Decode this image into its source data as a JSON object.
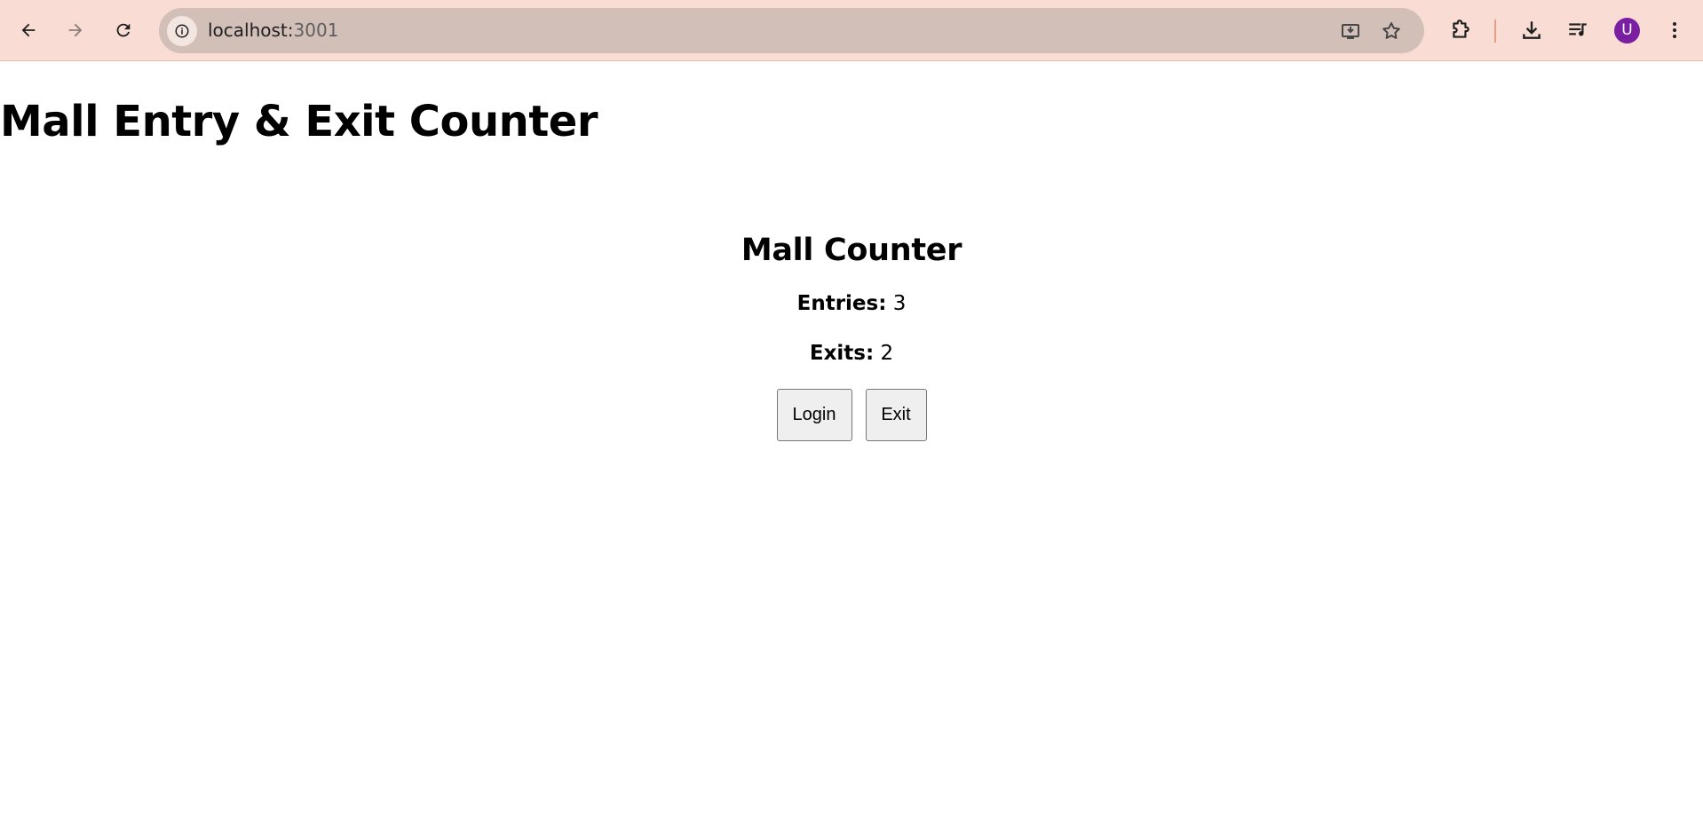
{
  "browser": {
    "url_host": "localhost:",
    "url_port": "3001",
    "avatar_letter": "U",
    "avatar_color": "#7b1fa2",
    "toolbar_color": "#f9ddd5",
    "omnibox_color": "#d2c0b8"
  },
  "page": {
    "title": "Mall Entry & Exit Counter",
    "counter": {
      "title": "Mall Counter",
      "entries_label": "Entries:",
      "entries_value": "3",
      "exits_label": "Exits:",
      "exits_value": "2",
      "login_button": "Login",
      "exit_button": "Exit"
    }
  }
}
